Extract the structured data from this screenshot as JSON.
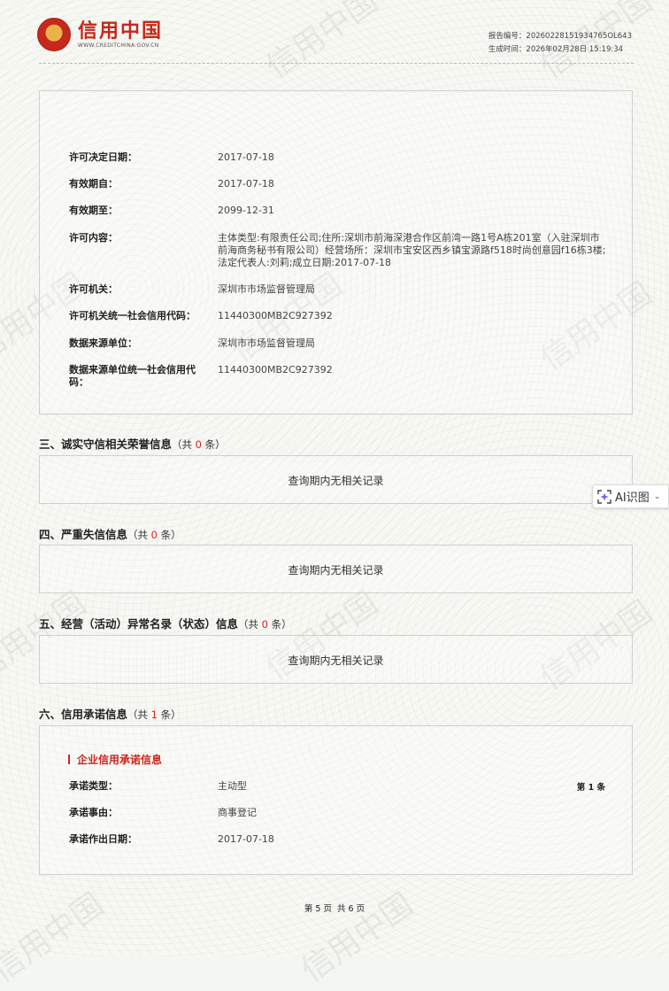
{
  "brand": {
    "title": "信用中国",
    "url": "WWW.CREDITCHINA.GOV.CN",
    "watermark": "信用中国"
  },
  "report": {
    "number": "报告编号：20260228151934765OL643",
    "generated": "生成时间：2026年02月28日 15:19:34"
  },
  "license": {
    "rows": [
      {
        "label": "许可决定日期：",
        "value": "2017-07-18"
      },
      {
        "label": "有效期自：",
        "value": "2017-07-18"
      },
      {
        "label": "有效期至：",
        "value": "2099-12-31"
      },
      {
        "label": "许可内容：",
        "value": "主体类型:有限责任公司;住所:深圳市前海深港合作区前湾一路1号A栋201室（入驻深圳市前海商务秘书有限公司）经营场所：深圳市宝安区西乡镇宝源路f518时尚创意园f16栋3楼;法定代表人:刘莉;成立日期:2017-07-18"
      },
      {
        "label": "许可机关：",
        "value": "深圳市市场监督管理局"
      },
      {
        "label": "许可机关统一社会信用代码：",
        "value": "11440300MB2C927392"
      },
      {
        "label": "数据来源单位：",
        "value": "深圳市市场监督管理局"
      },
      {
        "label": "数据来源单位统一社会信用代码：",
        "value": "11440300MB2C927392"
      }
    ]
  },
  "sections": [
    {
      "title": "三、诚实守信相关荣誉信息",
      "count_prefix": "（共 ",
      "count": "0",
      "count_suffix": " 条）",
      "empty": "查询期内无相关记录"
    },
    {
      "title": "四、严重失信信息",
      "count_prefix": "（共 ",
      "count": "0",
      "count_suffix": " 条）",
      "empty": "查询期内无相关记录"
    },
    {
      "title": "五、经营（活动）异常名录（状态）信息",
      "count_prefix": "（共 ",
      "count": "0",
      "count_suffix": " 条）",
      "empty": "查询期内无相关记录"
    },
    {
      "title": "六、信用承诺信息",
      "count_prefix": "（共 ",
      "count": "1",
      "count_suffix": " 条）"
    }
  ],
  "commitment": {
    "subhead": "企业信用承诺信息",
    "item_no": "第 1 条",
    "rows": [
      {
        "label": "承诺类型：",
        "value": "主动型"
      },
      {
        "label": "承诺事由：",
        "value": "商事登记"
      },
      {
        "label": "承诺作出日期：",
        "value": "2017-07-18"
      }
    ]
  },
  "footer": {
    "page": "第 5 页",
    "total": "共 6 页"
  },
  "ai_button": {
    "label": "AI识图"
  },
  "colors": {
    "brand_red": "#c5281c",
    "count_red": "#e0211b"
  }
}
